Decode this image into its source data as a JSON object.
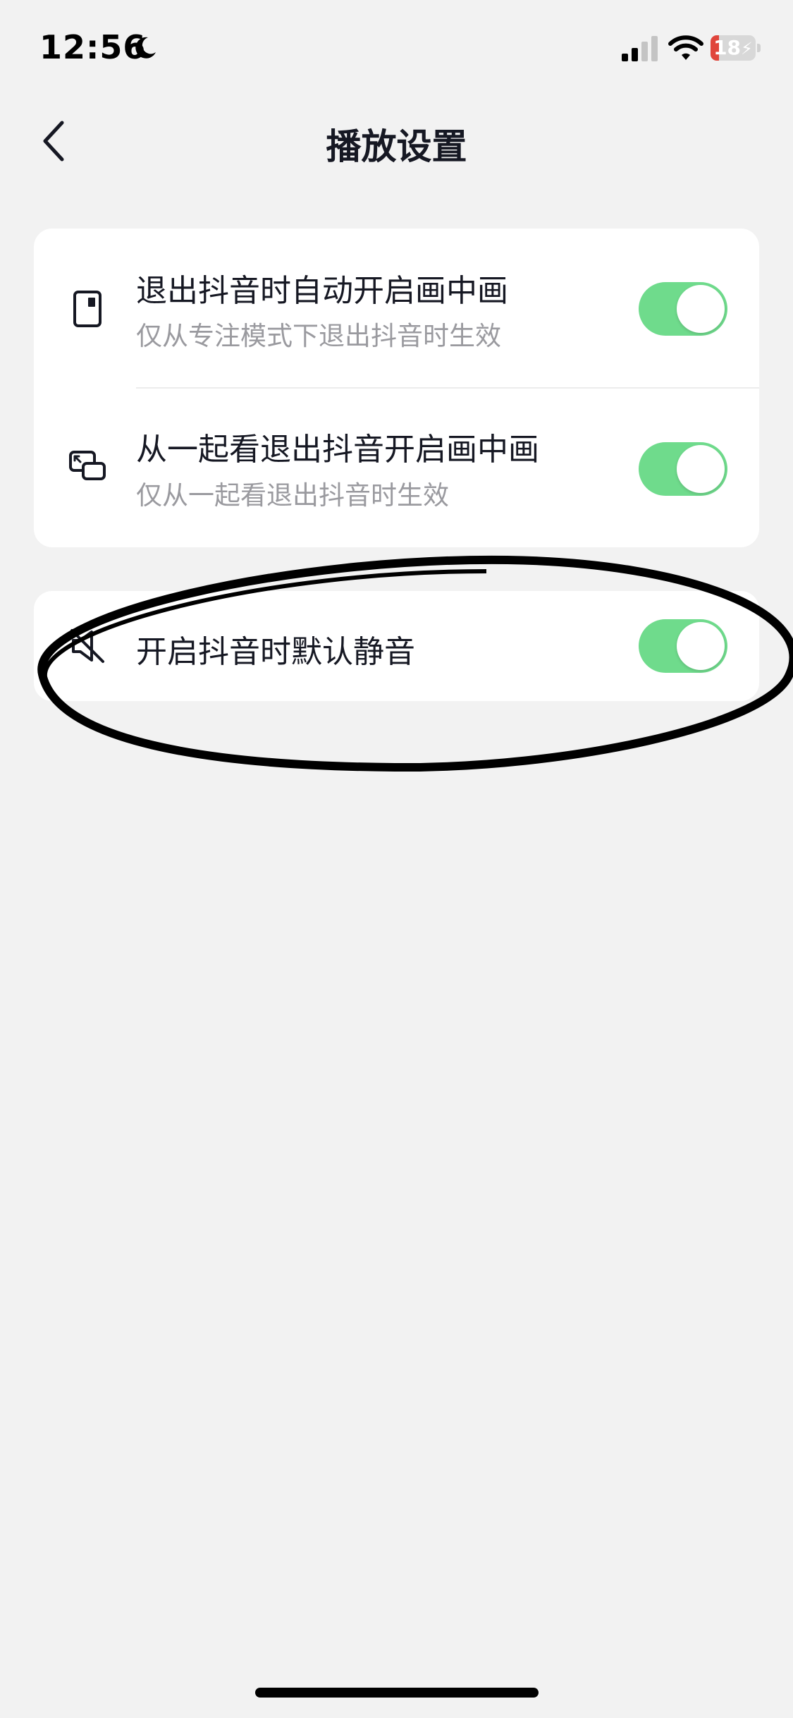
{
  "status_bar": {
    "time": "12:56",
    "battery_level": "18",
    "battery_fraction": 0.18,
    "battery_color": "#e0453c",
    "icons": [
      "moon-icon",
      "signal-icon",
      "wifi-icon",
      "battery-charging-icon"
    ]
  },
  "nav": {
    "title": "播放设置",
    "back_icon": "chevron-left-icon"
  },
  "settings": {
    "pip_group": [
      {
        "icon": "phone-pip-icon",
        "title": "退出抖音时自动开启画中画",
        "subtitle": "仅从专注模式下退出抖音时生效",
        "enabled": true
      },
      {
        "icon": "watch-together-pip-icon",
        "title": "从一起看退出抖音开启画中画",
        "subtitle": "仅从一起看退出抖音时生效",
        "enabled": true
      }
    ],
    "mute_group": [
      {
        "icon": "speaker-muted-icon",
        "title": "开启抖音时默认静音",
        "enabled": true
      }
    ]
  },
  "colors": {
    "background": "#f2f2f2",
    "card": "#ffffff",
    "toggle_on": "#6fdb8c",
    "title_text": "#161823",
    "subtitle_text": "#9a9a9f"
  }
}
